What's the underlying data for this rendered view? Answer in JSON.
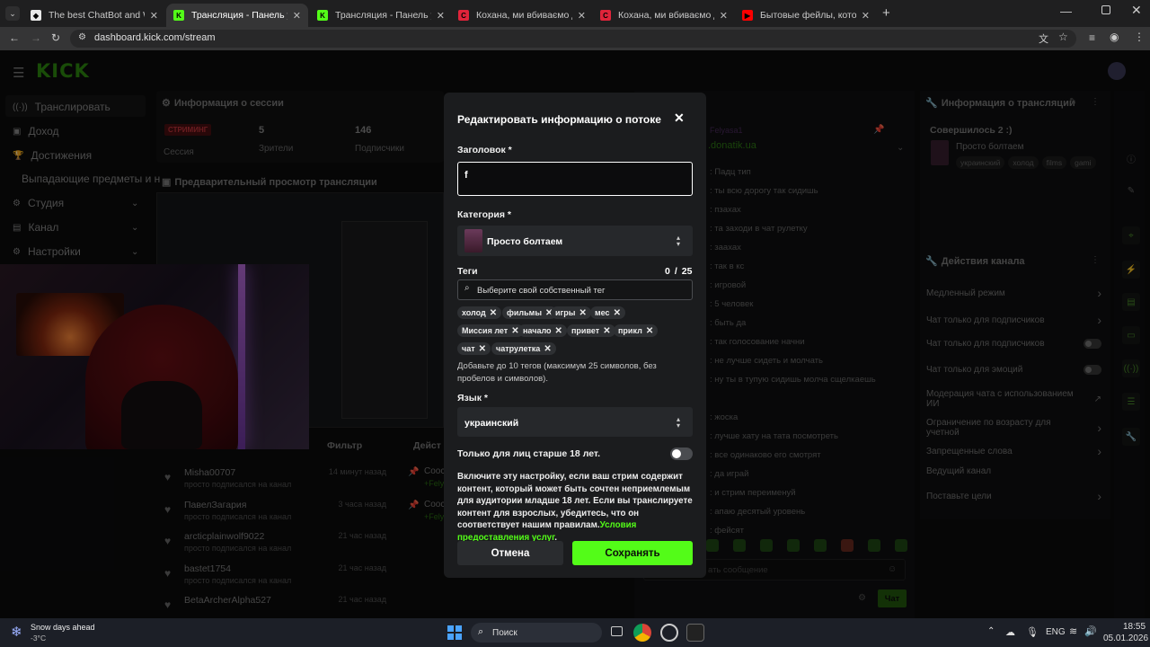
{
  "browser": {
    "tabs": [
      {
        "label": "The best ChatBot and Widgets",
        "active": false
      },
      {
        "label": "Трансляция - Панель управле",
        "active": true
      },
      {
        "label": "Трансляция - Панель управле",
        "active": false
      },
      {
        "label": "Кохана, ми вбиваємо дітей: Д",
        "active": false
      },
      {
        "label": "Кохана, ми вбиваємо дітей: К",
        "active": false
      },
      {
        "label": "Бытовые фейлы, которые ну",
        "active": false
      }
    ],
    "url": "dashboard.kick.com/stream"
  },
  "app": {
    "logo": "KICK",
    "nav": [
      {
        "label": "Транслировать",
        "icon": "broadcast-icon"
      },
      {
        "label": "Доход",
        "icon": "dollar-icon"
      },
      {
        "label": "Достижения",
        "icon": "trophy-icon"
      },
      {
        "label": "Выпадающие предметы и н",
        "icon": ""
      },
      {
        "label": "Студия",
        "icon": "studio-icon"
      },
      {
        "label": "Канал",
        "icon": "channel-icon"
      },
      {
        "label": "Настройки",
        "icon": "settings-icon"
      }
    ],
    "session": {
      "title": "Информация о сессии",
      "status_badge": "СТРИМИНГ",
      "status_label": "Сессия",
      "viewers_value": "5",
      "viewers_label": "Зрители",
      "subs_value": "146",
      "subs_label": "Подписчики"
    },
    "preview": {
      "title": "Предварительный просмотр трансляции"
    },
    "feed": {
      "filter_label": "Фильтр",
      "actions_label": "Дейст",
      "followers": [
        {
          "name": "Misha00707",
          "sub": "просто подписался на канал",
          "ago": "14 минут назад"
        },
        {
          "name": "ПавелЗагария",
          "sub": "просто подписался на канал",
          "ago": "3 часа назад"
        },
        {
          "name": "arcticplainwolf9022",
          "sub": "просто подписался на канал",
          "ago": "21 час назад"
        },
        {
          "name": "bastet1754",
          "sub": "просто подписался на канал",
          "ago": "21 час назад"
        },
        {
          "name": "BetaArcherAlpha527",
          "sub": "",
          "ago": "21 час назад"
        }
      ],
      "cards": [
        {
          "line1": "Cooc",
          "line2": "+Felya"
        },
        {
          "line1": "Cooc",
          "line2": "+Felya"
        }
      ]
    },
    "chat": {
      "pinned_user": "Felyasa1",
      "pinned_link": ".donatik.ua",
      "messages": [
        ": Падц тип",
        ": ты всю дорогу так сидишь",
        ": пзахах",
        ": та заходи в чат рулетку",
        ": заахах",
        ": так в кс",
        ": игровой",
        ": 5 человек",
        ": быть да",
        ": так голосование начни",
        ": не лучше сидеть и молчать",
        ": ну ты в тупую сидишь молча сщелкаешь",
        "",
        ": жоска",
        ": лучше хату на тата посмотреть",
        ": все одинаково его смотрят",
        ": да играй",
        ": и стрим переименуй",
        ": апаю десятый уровень",
        ": фейсят"
      ],
      "input_placeholder": "ать сообщение",
      "send_label": "Чат"
    },
    "stream_info": {
      "title": "Информация о трансляции",
      "done": "Совершилось 2 :)",
      "stream_title": "Просто болтаем",
      "tags": [
        "украинский",
        "холод",
        "films",
        "gami"
      ]
    },
    "channel_actions": {
      "title": "Действия канала",
      "items": [
        {
          "label": "Медленный режим",
          "control": "chevron"
        },
        {
          "label": "Чат только для подписчиков",
          "control": "chevron"
        },
        {
          "label": "Чат только для подписчиков",
          "control": "toggle"
        },
        {
          "label": "Чат только для эмоций",
          "control": "toggle"
        },
        {
          "label": "Модерация чата с использованием ИИ",
          "control": "external"
        },
        {
          "label": "Ограничение по возрасту для учетной",
          "control": "chevron"
        },
        {
          "label": "Запрещенные слова",
          "control": "chevron"
        },
        {
          "label": "Ведущий канал",
          "control": "none"
        },
        {
          "label": "Поставьте цели",
          "control": "chevron"
        }
      ]
    }
  },
  "modal": {
    "title": "Редактировать информацию о потоке",
    "title_label": "Заголовок *",
    "title_value": "f",
    "category_label": "Категория *",
    "category_value": "Просто болтаем",
    "tags_label": "Теги",
    "tags_count": "0",
    "tags_sep": "/",
    "tags_max": "25",
    "tags_placeholder": "Выберите свой собственный тег",
    "tags": [
      "холод",
      "фильмы",
      "игры",
      "мес",
      "Миссия лет",
      "начало",
      "привет",
      "прикл",
      "чат",
      "чатрулетка"
    ],
    "tags_hint": "Добавьте до 10 тегов (максимум 25 символов, без пробелов и символов).",
    "language_label": "Язык *",
    "language_value": "украинский",
    "adult_label": "Только для лиц старше 18 лет.",
    "adult_on": false,
    "adult_desc": "Включите эту настройку, если ваш стрим содержит контент, который может быть сочтен неприемлемым для аудитории младше 18 лет. Если вы транслируете контент для взрослых, убедитесь, что он соответствует нашим правилам.",
    "adult_link": "Условия предоставления услуг",
    "adult_end": ".",
    "cancel_label": "Отмена",
    "save_label": "Сохранять",
    "accent": "#53fc18"
  },
  "taskbar": {
    "weather_title": "Snow days ahead",
    "weather_temp": "-3°C",
    "search_label": "Поиск",
    "lang": "ENG",
    "time": "18:55",
    "date": "05.01.2026"
  }
}
